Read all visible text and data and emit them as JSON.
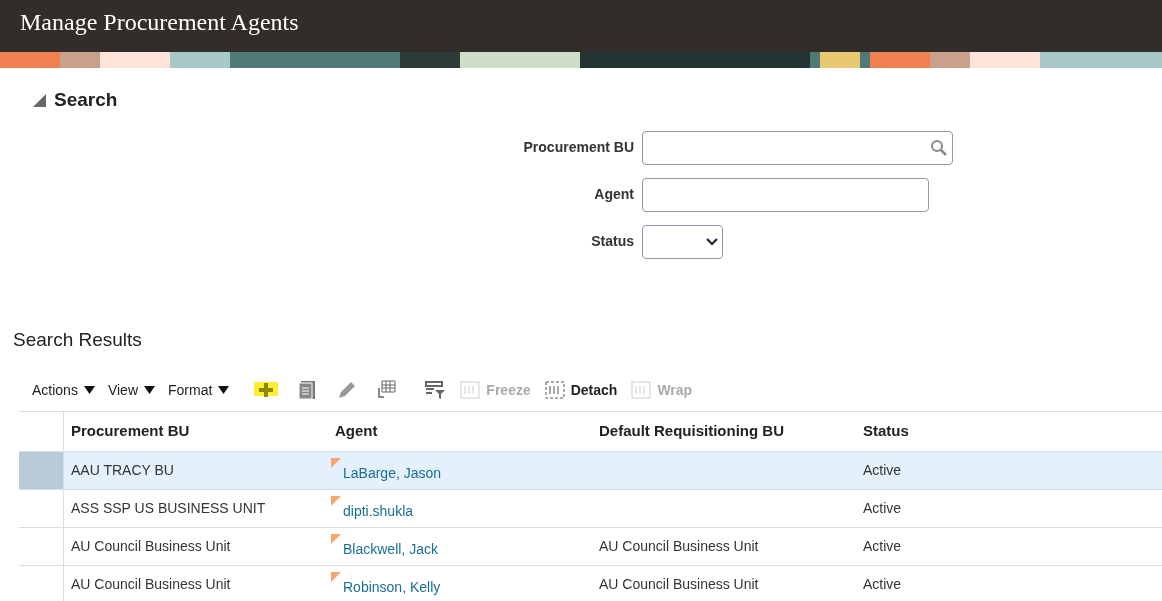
{
  "page_title": "Manage Procurement Agents",
  "search": {
    "title": "Search",
    "expanded": true,
    "fields": [
      {
        "kind": "lov",
        "label": "Procurement BU"
      },
      {
        "kind": "text",
        "label": "Agent"
      },
      {
        "kind": "select",
        "label": "Status"
      }
    ]
  },
  "results": {
    "title": "Search Results",
    "menus": [
      "Actions",
      "View",
      "Format"
    ],
    "buttons": [
      {
        "label": "Freeze",
        "disabled": true
      },
      {
        "label": "Detach",
        "disabled": false
      },
      {
        "label": "Wrap",
        "disabled": true
      }
    ],
    "columns": [
      "Procurement BU",
      "Agent",
      "Default Requisitioning BU",
      "Status"
    ],
    "rows": [
      {
        "selected": true,
        "bu": "AAU TRACY BU",
        "agent": "LaBarge, Jason",
        "default_bu": "",
        "status": "Active"
      },
      {
        "selected": false,
        "bu": "ASS SSP US BUSINESS UNIT",
        "agent": "dipti.shukla",
        "default_bu": "",
        "status": "Active"
      },
      {
        "selected": false,
        "bu": "AU Council Business Unit",
        "agent": "Blackwell, Jack",
        "default_bu": "AU Council Business Unit",
        "status": "Active"
      },
      {
        "selected": false,
        "bu": "AU Council Business Unit",
        "agent": "Robinson, Kelly",
        "default_bu": "AU Council Business Unit",
        "status": "Active"
      }
    ]
  }
}
